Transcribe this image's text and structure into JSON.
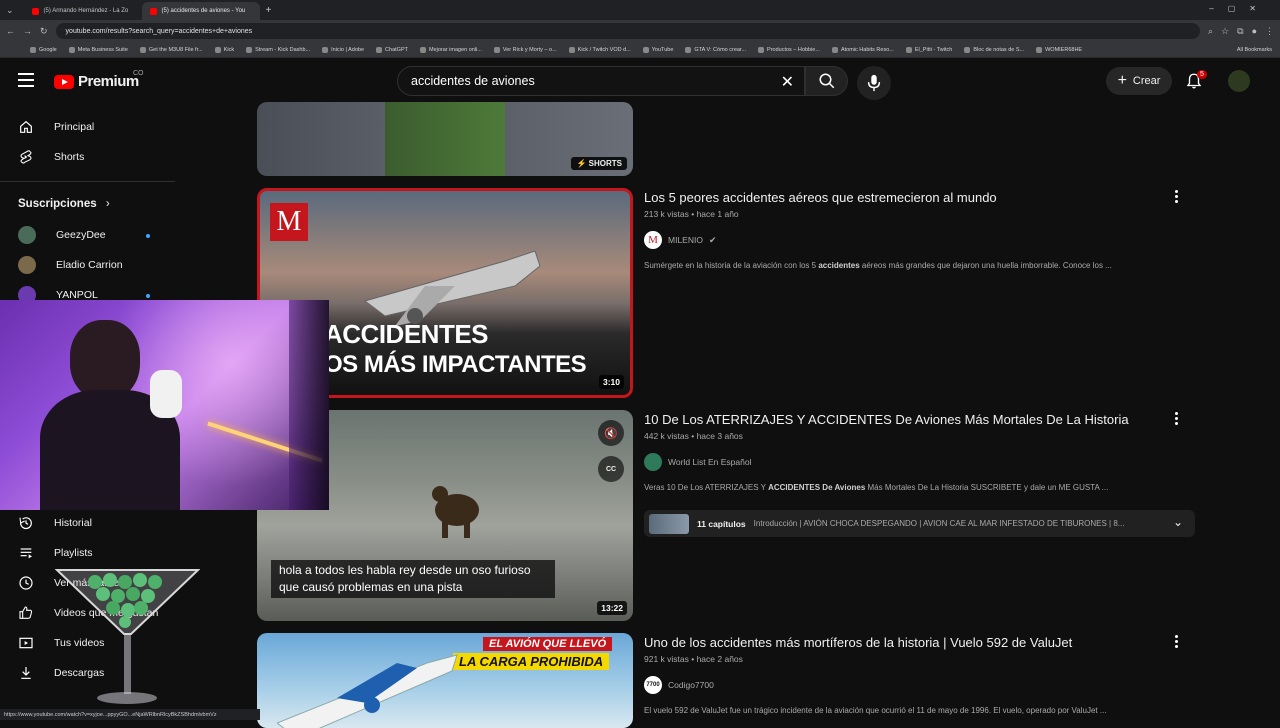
{
  "browser": {
    "tabs": [
      {
        "label": "(5) Armando Hernández - La Zo",
        "active": false
      },
      {
        "label": "(5) accidentes de aviones - You",
        "active": true
      }
    ],
    "url": "youtube.com/results?search_query=accidentes+de+aviones",
    "bookmarks": [
      "Google",
      "Meta Business Suite",
      "Get the M3U8 File fr...",
      "Kick",
      "Stream - Kick Dashb...",
      "Inicio | Adobe",
      "ChatGPT",
      "Mejorar imagen onli...",
      "Ver Rick y Morty – o...",
      "Kick / Twitch VOD d...",
      "YouTube",
      "GTA V: Cómo crear...",
      "Productos – Hobbie...",
      "Atomic Habits Reso...",
      "El_Pitti - Twitch",
      "Bloc de notas de S...",
      "WOMIER68HE"
    ],
    "all_bookmarks": "All Bookmarks",
    "status_url": "https://www.youtube.com/watch?v=xyjoe...ppyyGO...eNjaWRlbnRlcyBkZSBhdmlvbmVz"
  },
  "header": {
    "logo": "Premium",
    "country": "CO",
    "search_value": "accidentes de aviones",
    "create_label": "Crear",
    "notification_count": "5"
  },
  "sidebar": {
    "items": [
      {
        "label": "Principal",
        "icon": "home-icon"
      },
      {
        "label": "Shorts",
        "icon": "shorts-icon"
      }
    ],
    "subscriptions_title": "Suscripciones",
    "subscriptions": [
      {
        "name": "GeezyDee",
        "color": "#4a6b5a"
      },
      {
        "name": "Eladio Carrion",
        "color": "#7a6a4a"
      },
      {
        "name": "YANPOL",
        "color": "#6a3ab0"
      }
    ],
    "lower_items": [
      {
        "label": "Historial",
        "icon": "history-icon"
      },
      {
        "label": "Playlists",
        "icon": "playlist-icon"
      },
      {
        "label": "Ver más tarde",
        "icon": "clock-icon"
      },
      {
        "label": "Videos que me gustan",
        "icon": "like-icon"
      },
      {
        "label": "Tus videos",
        "icon": "video-icon"
      },
      {
        "label": "Descargas",
        "icon": "download-icon"
      }
    ]
  },
  "results": {
    "shorts_badge": "SHORTS",
    "videos": [
      {
        "title": "Los 5 peores accidentes aéreos que estremecieron al mundo",
        "meta": "213 k vistas • hace 1 año",
        "channel": "MILENIO",
        "verified": true,
        "desc_pre": "Sumérgete en la historia de la aviación con los 5 ",
        "desc_bold": "accidentes",
        "desc_post": " aéreos más grandes que dejaron una huella imborrable. Conoce los ...",
        "duration": "3:10",
        "thumb_text1": "ACCIDENTES",
        "thumb_text2": "OS MÁS IMPACTANTES"
      },
      {
        "title": "10 De Los ATERRIZAJES Y ACCIDENTES De Aviones Más Mortales De La Historia",
        "meta": "442 k vistas • hace 3 años",
        "channel": "World List En Español",
        "desc_pre": "Veras 10 De Los ATERRIZAJES Y ",
        "desc_bold": "ACCIDENTES De Aviones",
        "desc_post": " Más Mortales De La Historia SUSCRIBETE y dale un ME GUSTA ...",
        "duration": "13:22",
        "caption": "hola a todos les habla rey desde un oso furioso que causó problemas en una pista",
        "chapters_count": "11 capítulos",
        "chapters_text": "Introducción | AVIÓN CHOCA DESPEGANDO | AVION CAE AL MAR INFESTADO DE TIBURONES | 8..."
      },
      {
        "title": "Uno de los accidentes más mortíferos de la historia | Vuelo 592 de ValuJet",
        "meta": "921 k vistas • hace 2 años",
        "channel": "Codigo7700",
        "desc": "El vuelo 592 de ValuJet fue un trágico incidente de la aviación que ocurrió el 11 de mayo de 1996. El vuelo, operado por ValuJet ...",
        "thumb_text1": "EL AVIÓN QUE LLEVÓ",
        "thumb_text2": "LA CARGA PROHIBIDA"
      }
    ]
  }
}
